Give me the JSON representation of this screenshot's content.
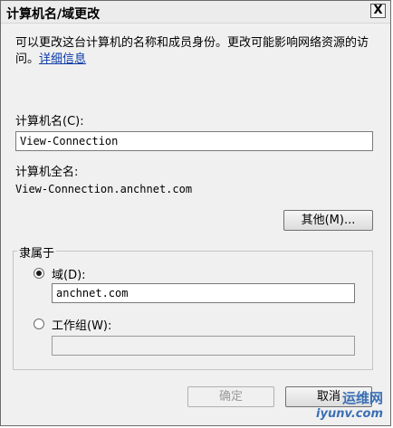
{
  "window": {
    "title": "计算机名/域更改",
    "close_label": "X"
  },
  "description": {
    "text": "可以更改这台计算机的名称和成员身份。更改可能影响网络资源的访问。",
    "link": "详细信息"
  },
  "computer_name": {
    "label": "计算机名(C):",
    "value": "View-Connection"
  },
  "full_name": {
    "label": "计算机全名:",
    "value": "View-Connection.anchnet.com"
  },
  "other_button": "其他(M)...",
  "member_of": {
    "title": "隶属于",
    "domain": {
      "label": "域(D):",
      "value": "anchnet.com",
      "selected": true
    },
    "workgroup": {
      "label": "工作组(W):",
      "value": "",
      "selected": false
    }
  },
  "buttons": {
    "ok": "确定",
    "cancel": "取消"
  },
  "watermark": {
    "brand": "运维网",
    "url": "iyunv.com"
  }
}
